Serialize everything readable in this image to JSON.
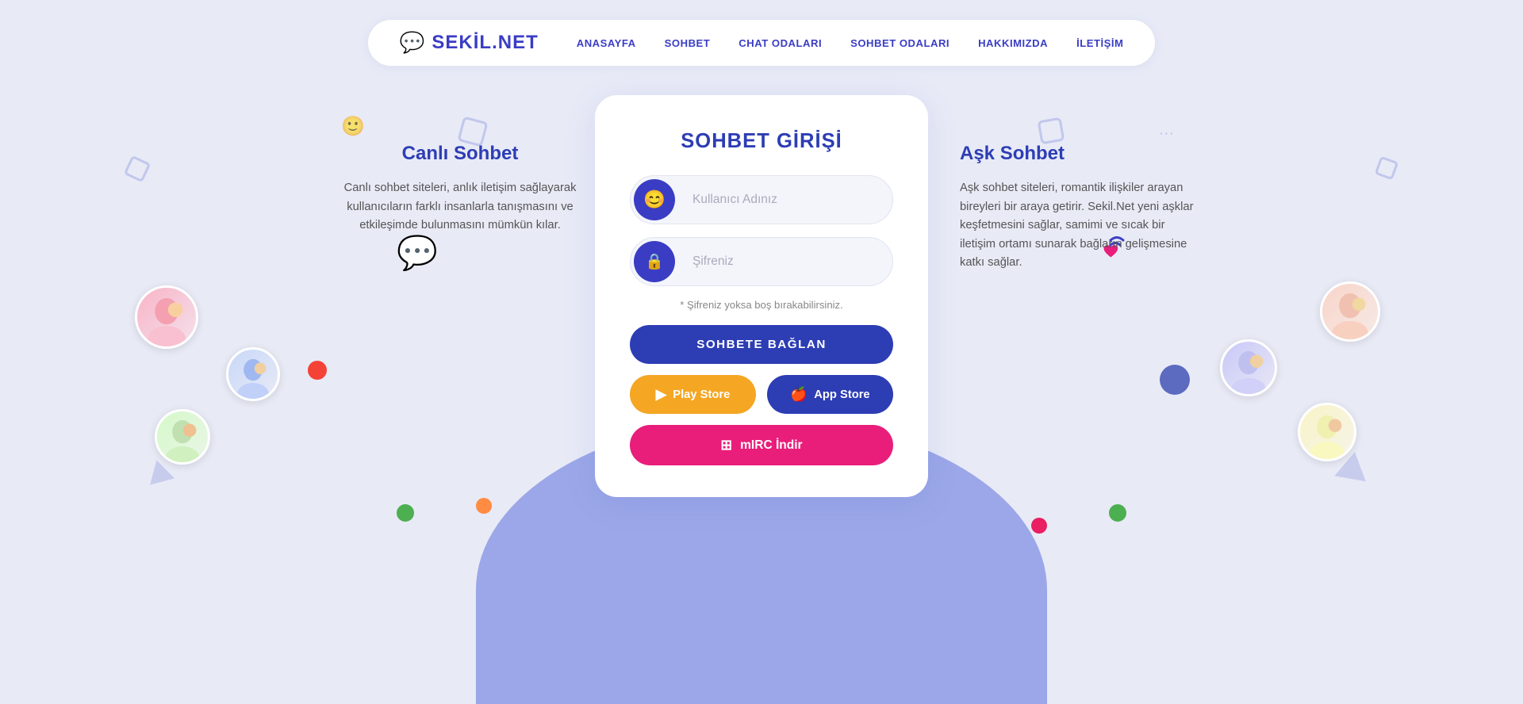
{
  "navbar": {
    "logo_text": "SEKİL.NET",
    "links": [
      {
        "label": "ANASAYFA",
        "name": "nav-anasayfa"
      },
      {
        "label": "SOHBET",
        "name": "nav-sohbet"
      },
      {
        "label": "CHAT ODALARI",
        "name": "nav-chat-odalari"
      },
      {
        "label": "SOHBET ODALARI",
        "name": "nav-sohbet-odalari"
      },
      {
        "label": "HAKKIMIZDA",
        "name": "nav-hakkimizda"
      },
      {
        "label": "İLETİŞİM",
        "name": "nav-iletisim"
      }
    ]
  },
  "left_panel": {
    "title": "Canlı Sohbet",
    "description": "Canlı sohbet siteleri, anlık iletişim sağlayarak kullanıcıların farklı insanlarla tanışmasını ve etkileşimde bulunmasını mümkün kılar."
  },
  "right_panel": {
    "title": "Aşk Sohbet",
    "description": "Aşk sohbet siteleri, romantik ilişkiler arayan bireyleri bir araya getirir. Sekil.Net yeni aşklar keşfetmesini sağlar, samimi ve sıcak bir iletişim ortamı sunarak bağların gelişmesine katkı sağlar."
  },
  "login_card": {
    "title": "SOHBET GİRİŞİ",
    "username_placeholder": "Kullanıcı Adınız",
    "password_placeholder": "Şifreniz",
    "hint": "* Şifreniz yoksa boş bırakabilirsiniz.",
    "connect_btn": "SOHBETE BAĞLAN",
    "play_store_btn": "Play Store",
    "app_store_btn": "App Store",
    "mirc_btn": "mIRC İndir"
  },
  "colors": {
    "primary": "#2d3db4",
    "orange": "#f5a623",
    "pink": "#e91e7a",
    "bg": "#e8eaf6",
    "arc": "#9ba7e8"
  }
}
